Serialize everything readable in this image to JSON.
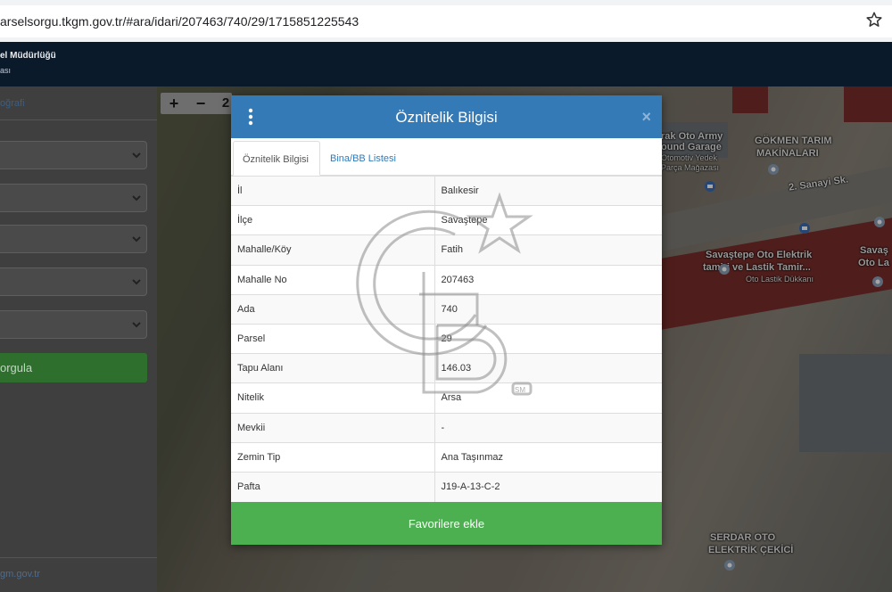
{
  "browser": {
    "url": "arselsorgu.tkgm.gov.tr/#ara/idari/207463/740/29/1715851225543"
  },
  "header": {
    "line1": "el Müdürlüğü",
    "line2": "ası"
  },
  "sidebar": {
    "top_link": "oğrafi",
    "query_button": "orgula",
    "footer": "gm.gov.tr"
  },
  "map": {
    "labels": [
      "rak Oto Army",
      "ound Garage",
      "Otomotiv Yedek",
      "Parça Mağazası",
      "GÖKMEN TARIM",
      "MAKİNALARI",
      "2. Sanayi Sk.",
      "Savaştepe Oto Elektrik",
      "tamiri ve Lastik Tamir...",
      "Oto Lastik Dükkanı",
      "SERDAR OTO",
      "ELEKTRİK ÇEKİCİ",
      "Savaş",
      "Oto La"
    ],
    "zoom_in": "+",
    "zoom_out": "−",
    "zoom_extra": "2"
  },
  "modal": {
    "title": "Öznitelik Bilgisi",
    "close": "×",
    "tabs": [
      "Öznitelik Bilgisi",
      "Bina/BB Listesi"
    ],
    "rows": [
      {
        "key": "İl",
        "value": "Balıkesir"
      },
      {
        "key": "İlçe",
        "value": "Savaştepe"
      },
      {
        "key": "Mahalle/Köy",
        "value": "Fatih"
      },
      {
        "key": "Mahalle No",
        "value": "207463"
      },
      {
        "key": "Ada",
        "value": "740"
      },
      {
        "key": "Parsel",
        "value": "29"
      },
      {
        "key": "Tapu Alanı",
        "value": "146.03"
      },
      {
        "key": "Nitelik",
        "value": "Arsa"
      },
      {
        "key": "Mevkii",
        "value": "-"
      },
      {
        "key": "Zemin Tip",
        "value": "Ana Taşınmaz"
      },
      {
        "key": "Pafta",
        "value": "J19-A-13-C-2"
      }
    ],
    "favorite_button": "Favorilere ekle"
  },
  "watermark": {
    "sm": "SM"
  },
  "colors": {
    "modal_header": "#337ab7",
    "favorite_button": "#4caf50",
    "app_header": "#0b1a2a"
  }
}
